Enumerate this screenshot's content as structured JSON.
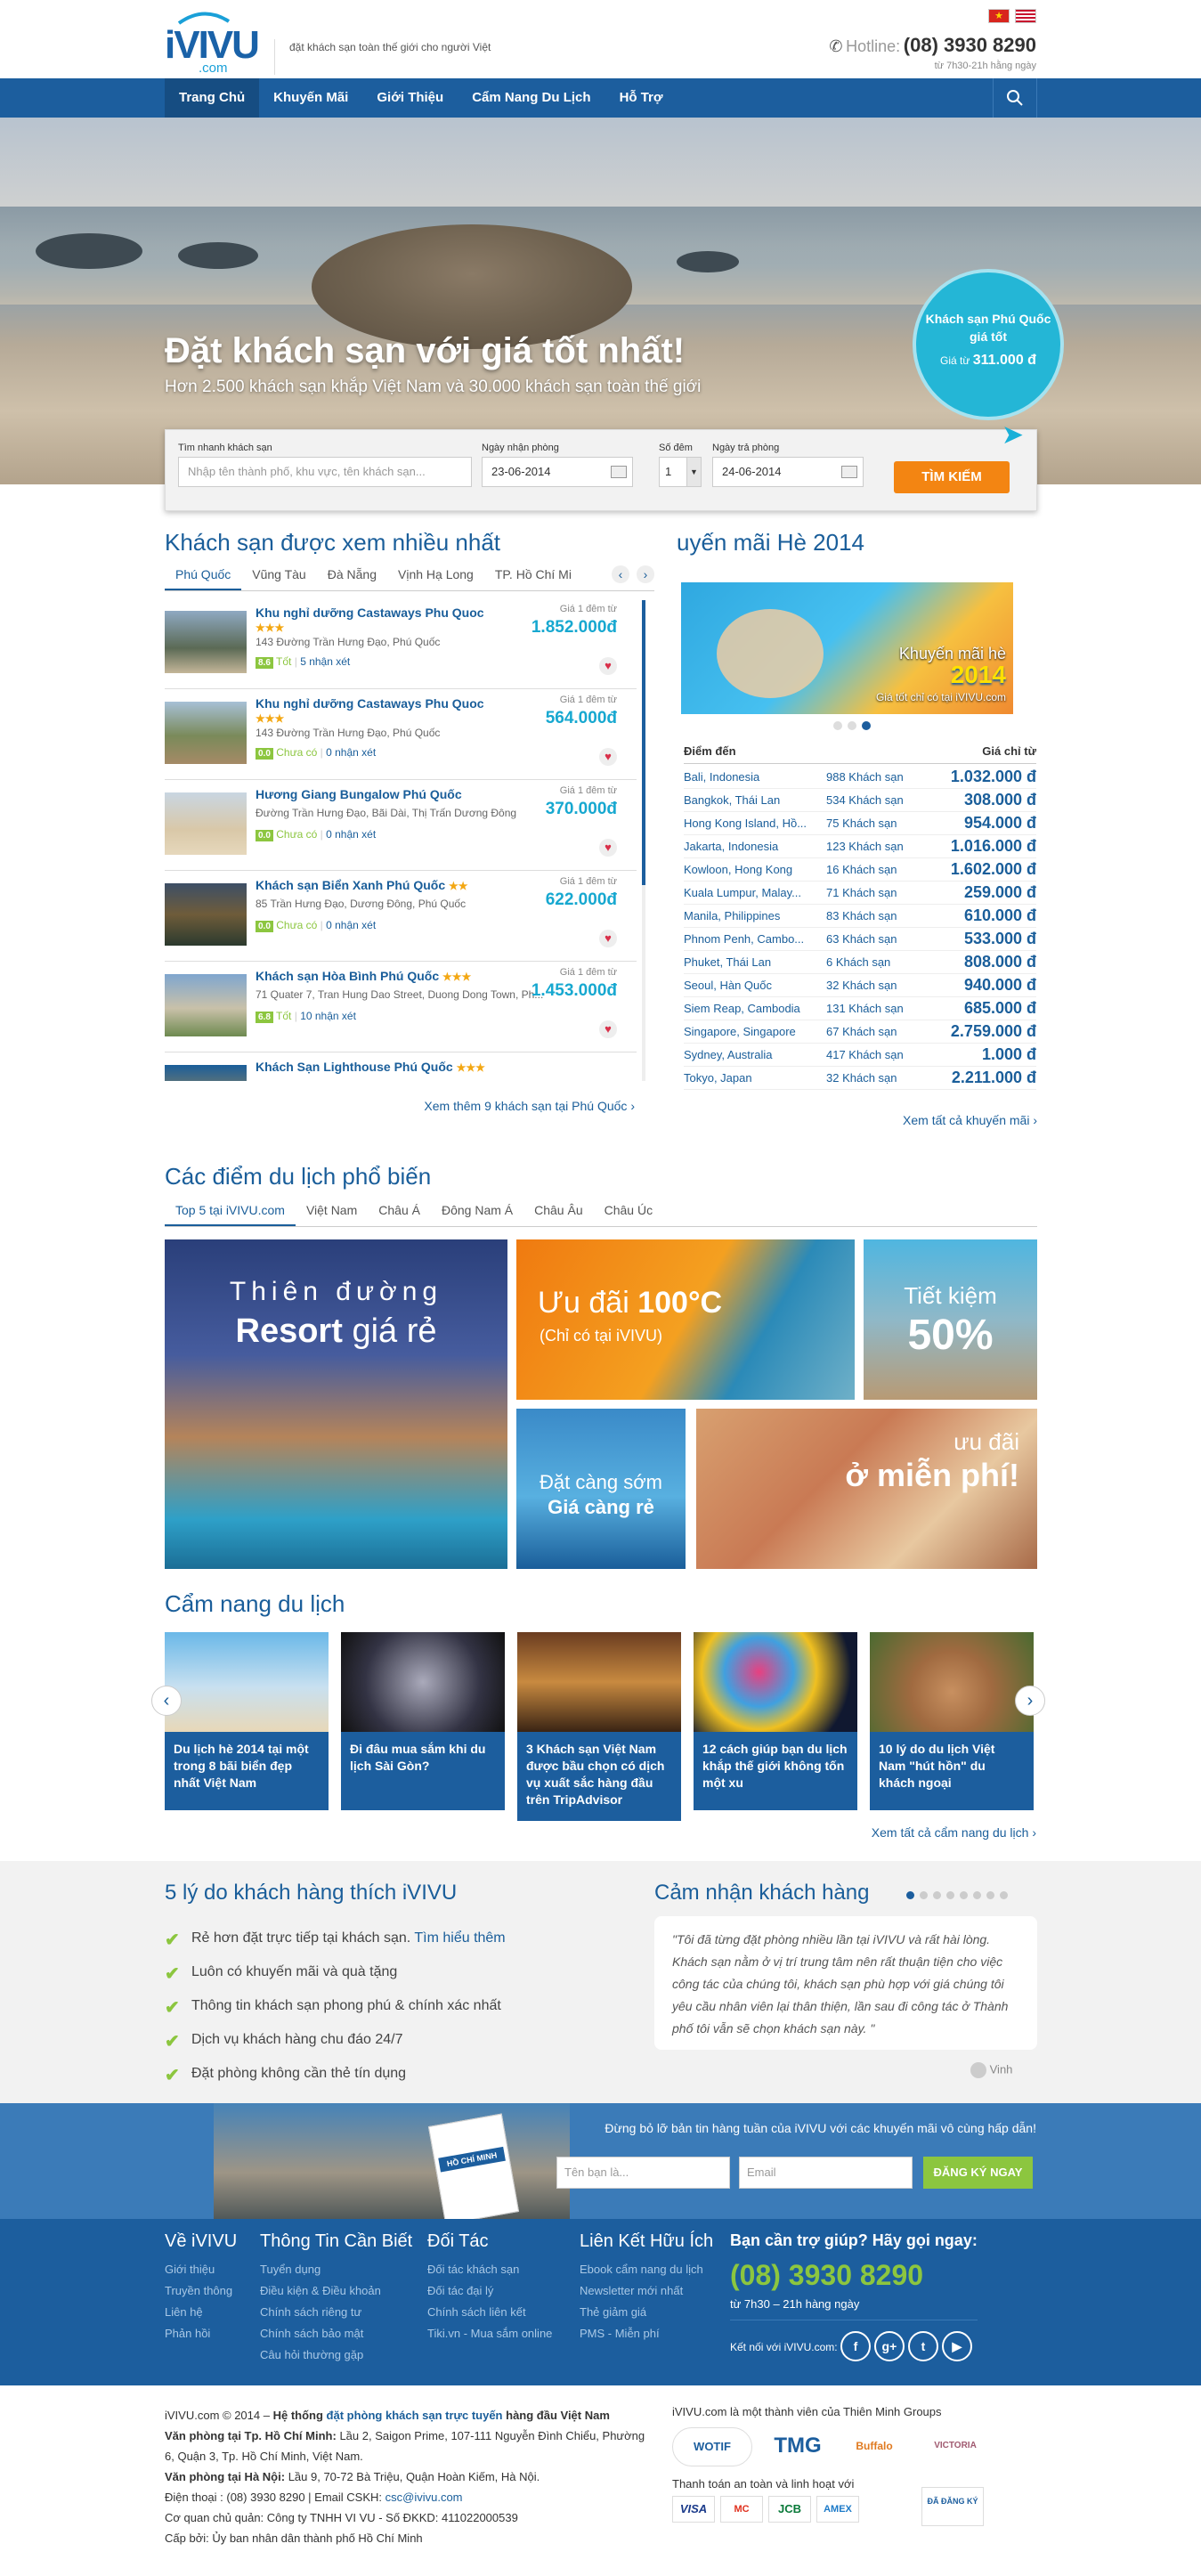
{
  "header": {
    "logo_text": "iVIVU",
    "logo_domain": ".com",
    "tagline": "đặt khách sạn toàn thế giới cho người Việt",
    "hotline_label": "Hotline:",
    "hotline_number": "(08) 3930 8290",
    "hotline_hours": "từ 7h30-21h hằng ngày"
  },
  "nav": {
    "items": [
      "Trang Chủ",
      "Khuyến Mãi",
      "Giới Thiệu",
      "Cẩm Nang Du Lịch",
      "Hỗ Trợ"
    ]
  },
  "hero": {
    "title": "Đặt khách sạn với giá tốt nhất!",
    "subtitle": "Hơn 2.500 khách sạn khắp Việt Nam và 30.000 khách sạn toàn thế giới",
    "bubble_title": "Khách sạn Phú Quốc giá tốt",
    "bubble_price_label": "Giá từ",
    "bubble_price": "311.000 đ"
  },
  "search": {
    "quick_label": "Tìm nhanh khách sạn",
    "quick_placeholder": "Nhập tên thành phố, khu vực, tên khách sạn...",
    "checkin_label": "Ngày nhận phòng",
    "checkin": "23-06-2014",
    "nights_label": "Số đêm",
    "nights": "1",
    "checkout_label": "Ngày trả phòng",
    "checkout": "24-06-2014",
    "button": "TÌM KIẾM"
  },
  "popular": {
    "title": "Khách sạn được xem nhiều nhất",
    "tabs": [
      "Phú Quốc",
      "Vũng Tàu",
      "Đà Nẵng",
      "Vịnh Hạ Long",
      "TP. Hồ Chí Mi"
    ],
    "price_label": "Giá 1 đêm từ",
    "hotels": [
      {
        "name": "Khu nghỉ dưỡng Castaways Phu Quoc",
        "stars": "★★★",
        "address": "143 Đường Trần Hưng Đạo, Phú Quốc",
        "score": "8.6",
        "score_text": "Tốt",
        "reviews": "5 nhận xét",
        "price": "1.852.000đ"
      },
      {
        "name": "Khu nghỉ dưỡng Castaways Phu Quoc",
        "stars": "★★★",
        "address": "143 Đường Trần Hưng Đạo, Phú Quốc",
        "score": "0.0",
        "score_text": "Chưa có",
        "reviews": "0 nhận xét",
        "price": "564.000đ"
      },
      {
        "name": "Hương Giang Bungalow Phú Quốc",
        "stars": "",
        "address": "Đường Trần Hưng Đạo, Bãi Dài, Thị Trấn Dương Đông",
        "score": "0.0",
        "score_text": "Chưa có",
        "reviews": "0 nhận xét",
        "price": "370.000đ"
      },
      {
        "name": "Khách sạn Biển Xanh Phú Quốc",
        "stars": "★★",
        "address": "85 Trần Hưng Đạo, Dương Đông, Phú Quốc",
        "score": "0.0",
        "score_text": "Chưa có",
        "reviews": "0 nhận xét",
        "price": "622.000đ"
      },
      {
        "name": "Khách sạn Hòa Bình Phú Quốc",
        "stars": "★★★",
        "address": "71 Quater 7, Tran Hung Dao Street, Duong Dong Town, Ph...",
        "score": "6.8",
        "score_text": "Tốt",
        "reviews": "10 nhận xét",
        "price": "1.453.000đ"
      },
      {
        "name": "Khách Sạn Lighthouse Phú Quốc",
        "stars": "★★★",
        "address": "",
        "score": "",
        "score_text": "",
        "reviews": "",
        "price": ""
      }
    ],
    "more": "Xem thêm 9 khách sạn tại Phú Quốc"
  },
  "promo": {
    "title": "uyến mãi Hè 2014",
    "banner_line1": "Khuyến mãi hè",
    "banner_year": "2014",
    "banner_line2": "Giá tốt chỉ có tại iVIVU.com",
    "col_dest": "Điểm đến",
    "col_price": "Giá chỉ từ",
    "rows": [
      {
        "dest": "Bali, Indonesia",
        "count": "988 Khách sạn",
        "price": "1.032.000 đ"
      },
      {
        "dest": "Bangkok, Thái Lan",
        "count": "534 Khách sạn",
        "price": "308.000 đ"
      },
      {
        "dest": "Hong Kong Island, Hồ...",
        "count": "75 Khách sạn",
        "price": "954.000 đ"
      },
      {
        "dest": "Jakarta, Indonesia",
        "count": "123 Khách sạn",
        "price": "1.016.000 đ"
      },
      {
        "dest": "Kowloon, Hong Kong",
        "count": "16 Khách sạn",
        "price": "1.602.000 đ"
      },
      {
        "dest": "Kuala Lumpur, Malay...",
        "count": "71 Khách sạn",
        "price": "259.000 đ"
      },
      {
        "dest": "Manila, Philippines",
        "count": "83 Khách sạn",
        "price": "610.000 đ"
      },
      {
        "dest": "Phnom Penh, Cambo...",
        "count": "63 Khách sạn",
        "price": "533.000 đ"
      },
      {
        "dest": "Phuket, Thái Lan",
        "count": "6 Khách sạn",
        "price": "808.000 đ"
      },
      {
        "dest": "Seoul, Hàn Quốc",
        "count": "32 Khách sạn",
        "price": "940.000 đ"
      },
      {
        "dest": "Siem Reap, Cambodia",
        "count": "131 Khách sạn",
        "price": "685.000 đ"
      },
      {
        "dest": "Singapore, Singapore",
        "count": "67 Khách sạn",
        "price": "2.759.000 đ"
      },
      {
        "dest": "Sydney, Australia",
        "count": "417 Khách sạn",
        "price": "1.000 đ"
      },
      {
        "dest": "Tokyo, Japan",
        "count": "32 Khách sạn",
        "price": "2.211.000 đ"
      }
    ],
    "more": "Xem tất cả khuyến mãi"
  },
  "destinations": {
    "title": "Các điểm du lịch phổ biến",
    "tabs": [
      "Top 5 tại iVIVU.com",
      "Việt Nam",
      "Châu Á",
      "Đông Nam Á",
      "Châu Âu",
      "Châu Úc"
    ],
    "tile1_a": "Thiên đường",
    "tile1_b": "Resort",
    "tile1_c": "giá rẻ",
    "tile2_a": "Ưu đãi",
    "tile2_b": "100°C",
    "tile2_c": "(Chỉ có tại iVIVU)",
    "tile3_a": "Tiết kiệm",
    "tile3_b": "50%",
    "tile4_a": "Đặt càng sớm",
    "tile4_b": "Giá càng rẻ",
    "tile5_a": "ưu đãi",
    "tile5_b": "ở miễn phí!"
  },
  "guides": {
    "title": "Cẩm nang du lịch",
    "items": [
      "Du lịch hè 2014 tại một trong 8 bãi biển đẹp nhất Việt Nam",
      "Đi đâu mua sắm khi du lịch Sài Gòn?",
      "3 Khách sạn Việt Nam được bầu chọn có dịch vụ xuất sắc hàng đầu trên TripAdvisor",
      "12 cách giúp bạn du lịch khắp thế giới không tốn một xu",
      "10 lý do du lịch Việt Nam \"hút hồn\" du khách ngoại"
    ],
    "more": "Xem tất cả cẩm nang du lịch"
  },
  "reasons": {
    "title": "5 lý do khách hàng thích iVIVU",
    "items": [
      "Rẻ hơn đặt trực tiếp tại khách sạn.",
      "Luôn có khuyến mãi và quà tặng",
      "Thông tin khách sạn phong phú & chính xác nhất",
      "Dịch vụ khách hàng chu đáo 24/7",
      "Đặt phòng không cần thẻ tín dụng"
    ],
    "link": "Tìm hiểu thêm"
  },
  "testimonial": {
    "title": "Cảm nhận khách hàng",
    "text": "\"Tôi đã từng đặt phòng nhiều lần tại iVIVU và rất hài lòng. Khách sạn nằm ở vị trí trung tâm nên rất thuận tiện cho việc công tác của chúng tôi, khách sạn phù hợp với giá chúng tôi yêu cầu nhân viên lại thân thiện, lần sau đi công tác ở Thành phố tôi vẫn sẽ chọn khách sạn này. \"",
    "author": "Vinh"
  },
  "newsletter": {
    "text": "Đừng bỏ lỡ bản tin hàng tuần của iVIVU với các khuyến mãi vô cùng hấp dẫn!",
    "name_placeholder": "Tên bạn là...",
    "email_placeholder": "Email",
    "button": "ĐĂNG KÝ NGAY",
    "book_title": "HỒ CHÍ MINH"
  },
  "footer": {
    "col1_title": "Về iVIVU",
    "col1": [
      "Giới thiệu",
      "Truyền thông",
      "Liên hệ",
      "Phản hồi"
    ],
    "col2_title": "Thông Tin Cần Biết",
    "col2": [
      "Tuyển dụng",
      "Điều kiện & Điều khoản",
      "Chính sách riêng tư",
      "Chính sách bảo mật",
      "Câu hỏi thường gặp"
    ],
    "col3_title": "Đối Tác",
    "col3": [
      "Đối tác khách sạn",
      "Đối tác đại lý",
      "Chính sách liên kết",
      "Tiki.vn - Mua sắm online"
    ],
    "col4_title": "Liên Kết Hữu Ích",
    "col4": [
      "Ebook cẩm nang du lịch",
      "Newsletter mới nhất",
      "Thẻ giảm giá",
      "PMS - Miễn phí"
    ],
    "help_title": "Bạn cần trợ giúp? Hãy gọi ngay:",
    "help_phone": "(08) 3930 8290",
    "help_hours": "từ 7h30 – 21h hàng ngày",
    "connect": "Kết nối với iVIVU.com:"
  },
  "bottom": {
    "line1_a": "iVIVU.com © 2014 –",
    "line1_b": "Hệ thống",
    "line1_c": "đặt phòng khách sạn trực tuyến",
    "line1_d": "hàng đầu Việt Nam",
    "hcm_label": "Văn phòng tại Tp. Hồ Chí Minh:",
    "hcm": "Lầu 2, Saigon Prime, 107-111 Nguyễn Đình Chiểu, Phường 6, Quận 3, Tp. Hồ Chí Minh, Việt Nam.",
    "hn_label": "Văn phòng tại Hà Nội:",
    "hn": "Lầu 9, 70-72 Bà Triệu, Quận Hoàn Kiếm, Hà Nội.",
    "contact": "Điện thoại : (08) 3930 8290 | Email CSKH:",
    "email": "csc@ivivu.com",
    "owner": "Cơ quan chủ quản: Công ty TNHH VI VU - Số ĐKKD: 411022000539",
    "license": "Cấp bởi: Ủy ban nhân dân thành phố Hồ Chí Minh",
    "group": "iVIVU.com là một thành viên của Thiên Minh Groups",
    "partners": [
      "WOTIF",
      "TMG",
      "Buffalo",
      "VICTORIA"
    ],
    "safe": "Thanh toán an toàn và linh hoạt với",
    "cards": [
      "VISA",
      "MC",
      "JCB",
      "AMEX"
    ],
    "registered": "ĐÃ ĐĂNG KÝ"
  }
}
